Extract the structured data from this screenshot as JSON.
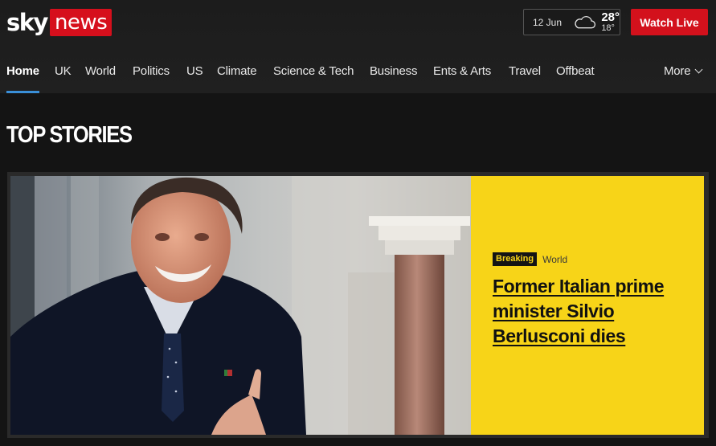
{
  "header": {
    "logo": {
      "sky": "sky",
      "news": "news"
    },
    "weather": {
      "date": "12 Jun",
      "icon": "cloud-icon",
      "high": "28°",
      "low": "18°"
    },
    "watch_live_label": "Watch Live"
  },
  "nav": {
    "items": [
      {
        "label": "Home",
        "active": true
      },
      {
        "label": "UK"
      },
      {
        "label": "World"
      },
      {
        "label": "Politics"
      },
      {
        "label": "US"
      },
      {
        "label": "Climate"
      },
      {
        "label": "Science & Tech"
      },
      {
        "label": "Business"
      },
      {
        "label": "Ents & Arts"
      },
      {
        "label": "Travel"
      },
      {
        "label": "Offbeat"
      }
    ],
    "more_label": "More",
    "active_color": "#3a8fd8"
  },
  "main": {
    "section_title": "TOP STORIES",
    "lead_story": {
      "badge": "Breaking",
      "category": "World",
      "headline": "Former Italian prime minister Silvio Berlusconi dies",
      "panel_color": "#f7d418"
    }
  },
  "colors": {
    "brand_red": "#d60f1c",
    "watch_live": "#d3111c",
    "background": "#141414"
  }
}
